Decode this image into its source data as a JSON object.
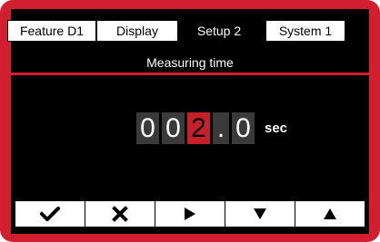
{
  "tabs": [
    {
      "label": "Feature  D1",
      "active": false
    },
    {
      "label": "Display",
      "active": false
    },
    {
      "label": "Setup 2",
      "active": true
    },
    {
      "label": "System 1",
      "active": false
    }
  ],
  "title": "Measuring  time",
  "value": {
    "digits": [
      "0",
      "0",
      "2",
      ".",
      "0"
    ],
    "selected_index": 2,
    "unit": "sec"
  },
  "softkeys": [
    {
      "icon": "check-icon"
    },
    {
      "icon": "close-icon"
    },
    {
      "icon": "arrow-right-icon"
    },
    {
      "icon": "arrow-down-icon"
    },
    {
      "icon": "arrow-up-icon"
    }
  ],
  "colors": {
    "accent": "#d21f2f",
    "screen": "#000000",
    "selected_digit": "#c8202a",
    "digit_bg": "#3a3a3a"
  }
}
